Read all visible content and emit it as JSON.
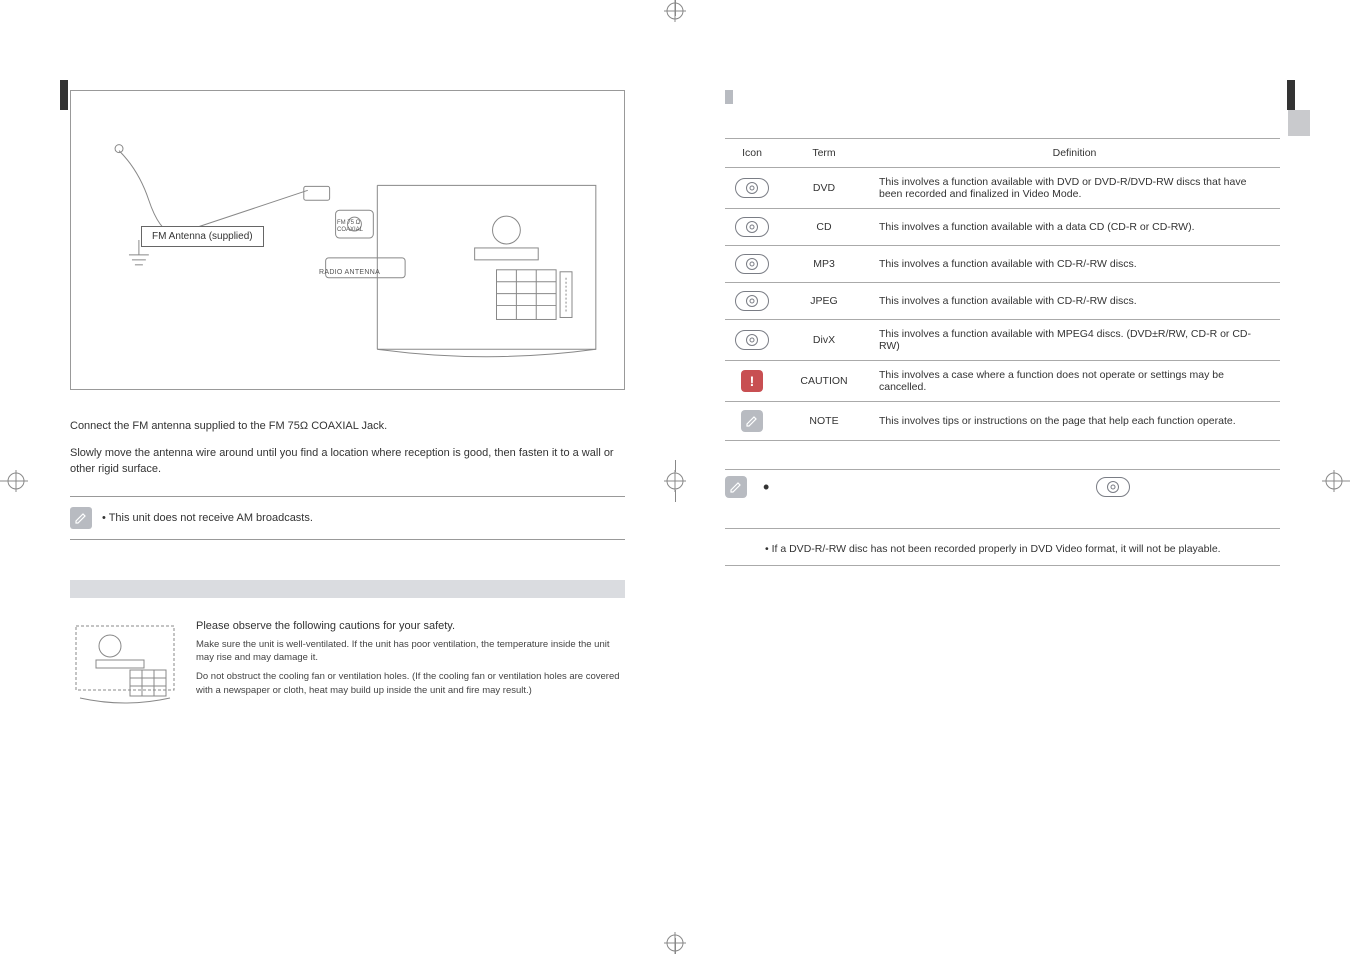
{
  "left": {
    "antenna_label": "FM Antenna (supplied)",
    "radio_antenna_label": "RADIO ANTENNA",
    "fm_plug_line1": "FM 75 Ω",
    "fm_plug_line2": "COAXIAL",
    "p1": "Connect the FM antenna supplied to the FM 75Ω COAXIAL Jack.",
    "p2": "Slowly move the antenna wire around until you find a location where reception is good, then fasten it to a wall or other rigid surface.",
    "note": "• This unit does not receive AM broadcasts.",
    "safety_hd": "Please observe the following cautions for your safety.",
    "safety_1": "Make sure the unit is well-ventilated. If the unit has poor ventilation, the temperature inside the unit may rise and may damage it.",
    "safety_2": "Do not obstruct the cooling fan or ventilation holes. (If the cooling fan or ventilation holes are covered with a newspaper or cloth, heat may build up inside the unit and fire may result.)"
  },
  "right": {
    "th_icon": "Icon",
    "th_term": "Term",
    "th_def": "Definition",
    "rows": [
      {
        "term": "DVD",
        "def": "This involves a function available with DVD or DVD-R/DVD-RW discs that have been recorded and finalized in Video Mode.",
        "icon": "disc"
      },
      {
        "term": "CD",
        "def": "This involves a function available with a data CD (CD-R or CD-RW).",
        "icon": "disc"
      },
      {
        "term": "MP3",
        "def": "This involves a function available with CD-R/-RW discs.",
        "icon": "disc"
      },
      {
        "term": "JPEG",
        "def": "This involves a function available with CD-R/-RW discs.",
        "icon": "disc"
      },
      {
        "term": "DivX",
        "def": "This involves a function available with MPEG4 discs. (DVD±R/RW, CD-R or CD-RW)",
        "icon": "disc"
      },
      {
        "term": "CAUTION",
        "def": "This involves a case where a function does not operate or settings may be cancelled.",
        "icon": "caution"
      },
      {
        "term": "NOTE",
        "def": "This involves tips or instructions on the page that help each function operate.",
        "icon": "note"
      }
    ],
    "footer_bullet": "•",
    "footer_sub": "• If a DVD-R/-RW disc has not been recorded properly in DVD Video format, it will not be playable."
  }
}
